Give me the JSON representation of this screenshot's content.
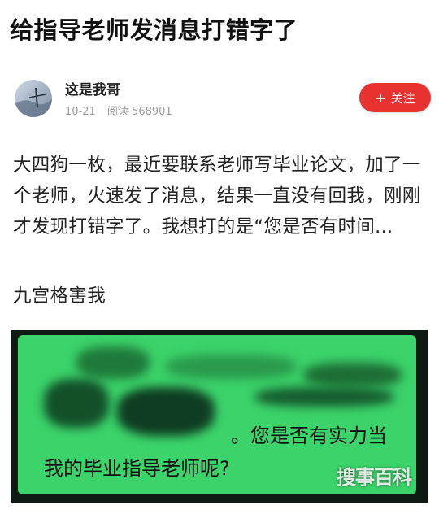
{
  "post": {
    "title": "给指导老师发消息打错字了",
    "author": {
      "name": "这是我哥",
      "date": "10-21",
      "views_label": "阅读 568901"
    },
    "follow_label": "关注",
    "follow_icon": "plus-icon",
    "paragraph1": "大四狗一枚，最近要联系老师写毕业论文，加了一个老师，火速发了消息，结果一直没有回我，刚刚才发现打错字了。我想打的是“您是否有时间...",
    "paragraph2": "九宫格害我"
  },
  "chat_screenshot": {
    "bubble_color": "#3bd36a",
    "line1": "。您是否有实力当",
    "line2": "我的毕业指导老师呢?"
  },
  "watermark": "搜事百科",
  "colors": {
    "accent": "#e8322f",
    "meta_text": "#9a9a9a"
  }
}
